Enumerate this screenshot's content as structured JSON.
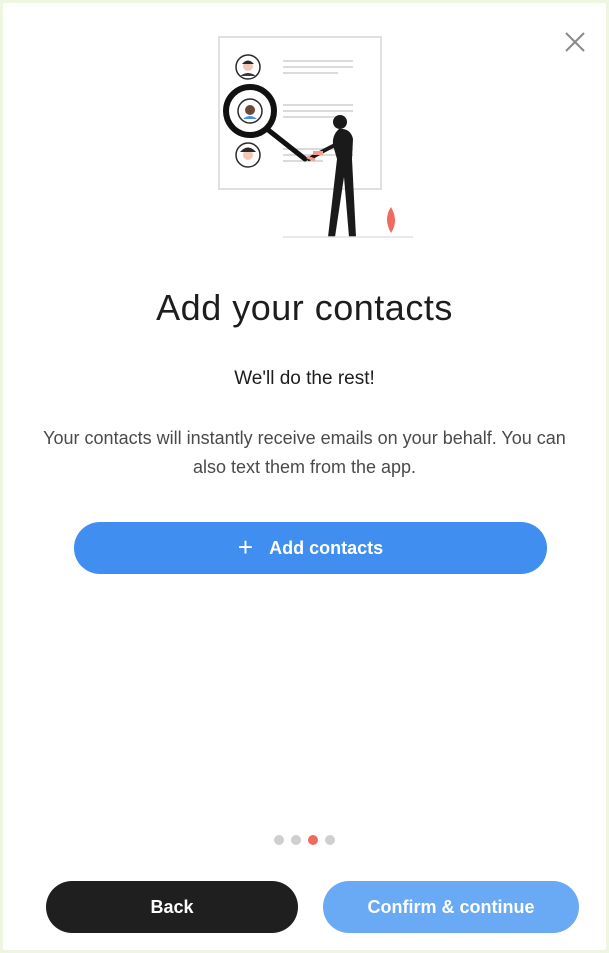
{
  "dialog": {
    "close_icon": "close-icon",
    "title": "Add your contacts",
    "subtitle": "We'll do the rest!",
    "description": "Your contacts will instantly receive emails on your behalf. You can also text them from the app."
  },
  "add_contacts": {
    "icon": "plus-icon",
    "label": "Add contacts"
  },
  "pagination": {
    "total": 4,
    "active_index": 3
  },
  "footer": {
    "back_label": "Back",
    "confirm_label": "Confirm & continue"
  },
  "colors": {
    "primary": "#3f8ef0",
    "primary_light": "#6aa9f4",
    "dark_button": "#1f1f1f",
    "active_dot": "#f06a5e",
    "inactive_dot": "#cfcfcf"
  }
}
